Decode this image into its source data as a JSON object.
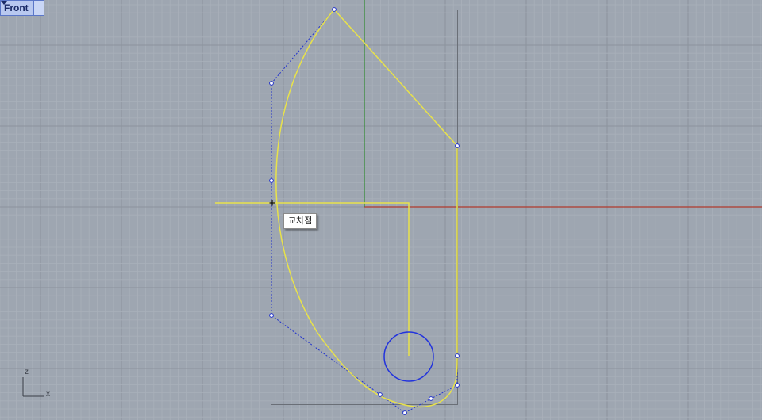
{
  "viewport": {
    "name": "Front",
    "snap_tooltip": "교차점",
    "axis_labels": {
      "vertical": "z",
      "horizontal": "x"
    }
  },
  "colors": {
    "background": "#9ea6b1",
    "grid_minor": "#a9b0ba",
    "grid_major": "#8c939d",
    "x_axis": "#b03a2e",
    "z_axis": "#2f8a2f",
    "curve": "#e8e24a",
    "control_polygon": "#2233cc",
    "circle": "#2233dd",
    "bounding_box": "#6a6f77"
  },
  "icons": {
    "view_menu": "chevron-down-icon",
    "snap_marker": "crosshair-icon"
  }
}
